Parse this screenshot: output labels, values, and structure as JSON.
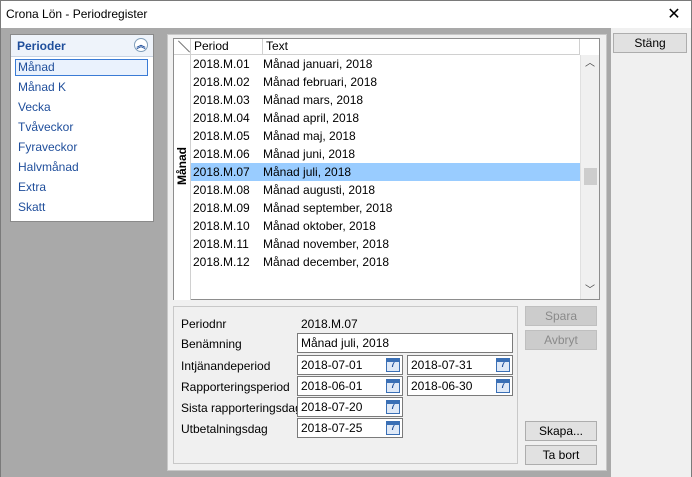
{
  "window": {
    "title": "Crona Lön - Periodregister",
    "close": "✕"
  },
  "sidebar": {
    "header": "Perioder",
    "collapse_icon": "double-chevron-up-icon",
    "items": [
      {
        "label": "Månad",
        "selected": true
      },
      {
        "label": "Månad K"
      },
      {
        "label": "Vecka"
      },
      {
        "label": "Tvåveckor"
      },
      {
        "label": "Fyraveckor"
      },
      {
        "label": "Halvmånad"
      },
      {
        "label": "Extra"
      },
      {
        "label": "Skatt"
      }
    ]
  },
  "grid": {
    "tab_label": "Månad",
    "columns": [
      "Period",
      "Text"
    ],
    "rows": [
      {
        "period": "2018.M.01",
        "text": "Månad januari, 2018"
      },
      {
        "period": "2018.M.02",
        "text": "Månad februari, 2018"
      },
      {
        "period": "2018.M.03",
        "text": "Månad mars, 2018"
      },
      {
        "period": "2018.M.04",
        "text": "Månad april, 2018"
      },
      {
        "period": "2018.M.05",
        "text": "Månad maj, 2018"
      },
      {
        "period": "2018.M.06",
        "text": "Månad juni, 2018"
      },
      {
        "period": "2018.M.07",
        "text": "Månad juli, 2018"
      },
      {
        "period": "2018.M.08",
        "text": "Månad augusti, 2018"
      },
      {
        "period": "2018.M.09",
        "text": "Månad september, 2018"
      },
      {
        "period": "2018.M.10",
        "text": "Månad oktober, 2018"
      },
      {
        "period": "2018.M.11",
        "text": "Månad november, 2018"
      },
      {
        "period": "2018.M.12",
        "text": "Månad december, 2018"
      }
    ],
    "selected_row": "2018.M.07"
  },
  "form": {
    "periodnr_label": "Periodnr",
    "periodnr_value": "2018.M.07",
    "benamning_label": "Benämning",
    "benamning_value": "Månad juli, 2018",
    "intjanande_label": "Intjänandeperiod",
    "intjanande_from": "2018-07-01",
    "intjanande_to": "2018-07-31",
    "rapportering_label": "Rapporteringsperiod",
    "rapportering_from": "2018-06-01",
    "rapportering_to": "2018-06-30",
    "sista_label": "Sista rapporteringsdag",
    "sista_value": "2018-07-20",
    "utbetalning_label": "Utbetalningsdag",
    "utbetalning_value": "2018-07-25",
    "calendar_glyph": "7"
  },
  "buttons": {
    "stang": "Stäng",
    "spara": "Spara",
    "avbryt": "Avbryt",
    "skapa": "Skapa...",
    "ta_bort": "Ta bort"
  },
  "colors": {
    "selection": "#99ccff",
    "sidebar_text": "#1f4e9b",
    "pane_gray": "#a9a9a9"
  }
}
